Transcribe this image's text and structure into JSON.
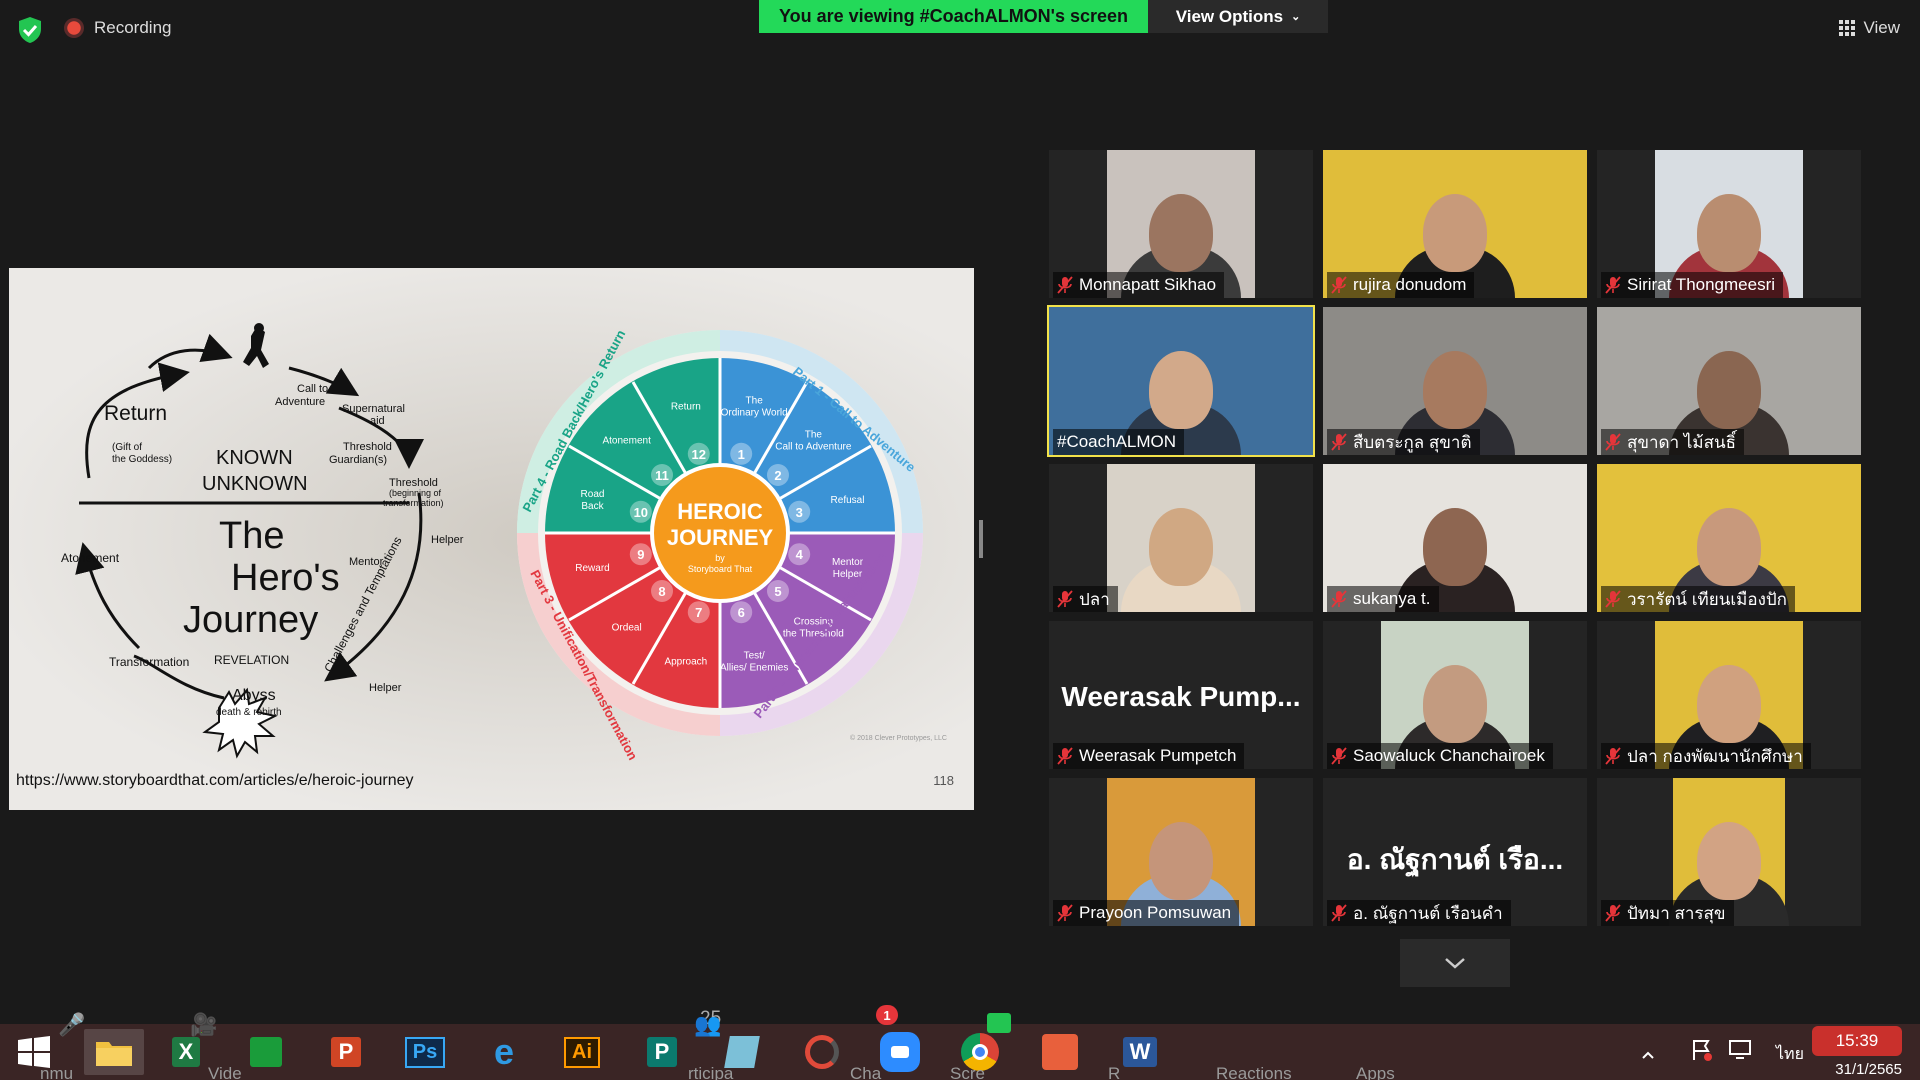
{
  "top": {
    "recording_label": "Recording",
    "viewing_banner": "You are viewing #CoachALMON's screen",
    "view_options_label": "View Options",
    "view_label": "View"
  },
  "slide": {
    "url": "https://www.storyboardthat.com/articles/e/heroic-journey",
    "page": "118",
    "title_lines": [
      "The",
      "Hero's",
      "Journey"
    ],
    "known": "KNOWN",
    "unknown": "UNKNOWN",
    "cycle_labels": {
      "return": "Return",
      "gift": "(Gift of",
      "gift2": "the Goddess)",
      "call": "Call to",
      "call2": "Adventure",
      "supernatural": "Supernatural",
      "aid": "aid",
      "threshold_g": "Threshold",
      "guardians": "Guardian(s)",
      "threshold": "Threshold",
      "beginning": "(beginning of",
      "transformation_paren": "transformation)",
      "helper": "Helper",
      "mentor": "Mentor",
      "challenges": "Challenges and Temptations",
      "atonement": "Atonement",
      "transformation": "Transformation",
      "revelation": "REVELATION",
      "abyss": "Abyss",
      "death": "death & rebirth",
      "helper2": "Helper"
    },
    "wheel": {
      "center1": "HEROIC",
      "center2": "JOURNEY",
      "center3": "by",
      "center4": "Storyboard That",
      "part1": "Part 1 - Call to Adventure",
      "part2": "Part 2 - Supreme Ordeal/Initiation",
      "part3": "Part 3 - Unification/Transformation",
      "part4": "Part 4 - Road Back/Hero's Return",
      "copyright": "© 2018 Clever Prototypes, LLC",
      "steps": [
        {
          "n": "1",
          "label": "The Ordinary World"
        },
        {
          "n": "2",
          "label": "The Call to Adventure"
        },
        {
          "n": "3",
          "label": "Refusal"
        },
        {
          "n": "4",
          "label": "Mentor Helper"
        },
        {
          "n": "5",
          "label": "Crossing the Threshold"
        },
        {
          "n": "6",
          "label": "Test/ Allies/ Enemies"
        },
        {
          "n": "7",
          "label": "Approach"
        },
        {
          "n": "8",
          "label": "Ordeal"
        },
        {
          "n": "9",
          "label": "Reward"
        },
        {
          "n": "10",
          "label": "Road Back"
        },
        {
          "n": "11",
          "label": "Atonement"
        },
        {
          "n": "12",
          "label": "Return"
        }
      ]
    }
  },
  "participants": [
    {
      "name": "Monnapatt Sikhao",
      "bg": "#c9c2bd",
      "skin": "#9b7560",
      "shirt": "#3b3b3b",
      "wide": false,
      "active": false,
      "muted": true
    },
    {
      "name": "rujira donudom",
      "bg": "#e0bd3a",
      "skin": "#c89a7a",
      "shirt": "#1e1e1e",
      "wide": true,
      "active": false,
      "muted": true
    },
    {
      "name": "Sirirat Thongmeesri",
      "bg": "#d8dde2",
      "skin": "#b98d70",
      "shirt": "#a2343c",
      "wide": false,
      "active": false,
      "muted": true
    },
    {
      "name": "#CoachALMON",
      "bg": "#3f6f9c",
      "skin": "#d2a98a",
      "shirt": "#2c3a4c",
      "wide": true,
      "active": true,
      "muted": false
    },
    {
      "name": "สืบตระกูล สุขาติ",
      "bg": "#8d8b87",
      "skin": "#a77a5f",
      "shirt": "#2d2d33",
      "wide": true,
      "active": false,
      "muted": true
    },
    {
      "name": "สุขาดา ไม้สนธิ์",
      "bg": "#a8a6a2",
      "skin": "#8a6651",
      "shirt": "#3a3330",
      "wide": true,
      "active": false,
      "muted": true
    },
    {
      "name": "ปลา",
      "bg": "#d8d2c8",
      "skin": "#d0a883",
      "shirt": "#e8d8c4",
      "wide": false,
      "active": false,
      "muted": true
    },
    {
      "name": "sukanya t.",
      "bg": "#e6e3de",
      "skin": "#8e6651",
      "shirt": "#2a2222",
      "wide": true,
      "active": false,
      "muted": true
    },
    {
      "name": "วรารัตน์ เทียนเมืองปัก",
      "bg": "#e3c13c",
      "skin": "#c8997c",
      "shirt": "#3c3a44",
      "wide": true,
      "active": false,
      "muted": true
    },
    {
      "name": "Weerasak Pumpetch",
      "big": "Weerasak  Pump...",
      "bg": "#242424",
      "wide": true,
      "active": false,
      "muted": true,
      "novideo": true
    },
    {
      "name": "Saowaluck Chanchairoek",
      "bg": "#c8d3c4",
      "skin": "#c39b80",
      "shirt": "#2d2a2a",
      "wide": false,
      "active": false,
      "muted": true
    },
    {
      "name": "ปลา กองพัฒนานักศึกษา",
      "bg": "#e0bd3a",
      "skin": "#d0a17f",
      "shirt": "#1f1f22",
      "wide": false,
      "active": false,
      "muted": true
    },
    {
      "name": "Prayoon Pomsuwan",
      "bg": "#d99a3a",
      "skin": "#c5957a",
      "shirt": "#8fb0d8",
      "wide": false,
      "active": false,
      "muted": true
    },
    {
      "name": "อ. ณัฐกานต์ เรือนคำ",
      "big": "อ. ณัฐกานต์  เรือ...",
      "bg": "#242424",
      "wide": true,
      "active": false,
      "muted": true,
      "novideo": true
    },
    {
      "name": "ปัทมา สารสุข",
      "bg": "#e0bd3a",
      "skin": "#d2a384",
      "shirt": "#2a2a2a",
      "wide": false,
      "active": false,
      "muted": true,
      "narrow": true
    }
  ],
  "taskbar": {
    "participants_count": "25",
    "chat_badge": "1",
    "ghost_labels": [
      "nmu",
      "Vide",
      "rticipa",
      "Cha",
      "S",
      "Scre",
      "R",
      "Reactions",
      "Apps"
    ],
    "lang": "ไทย",
    "time": "15:39",
    "date": "31/1/2565",
    "lock_text": "L"
  }
}
